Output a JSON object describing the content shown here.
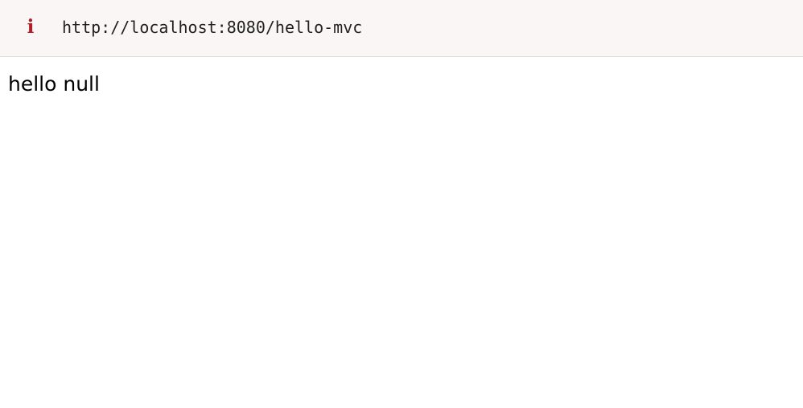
{
  "address_bar": {
    "icon": "info-icon",
    "url": "http://localhost:8080/hello-mvc"
  },
  "content": {
    "text": "hello null"
  },
  "colors": {
    "info_icon": "#b0202a",
    "address_bar_bg": "#faf6f6"
  }
}
